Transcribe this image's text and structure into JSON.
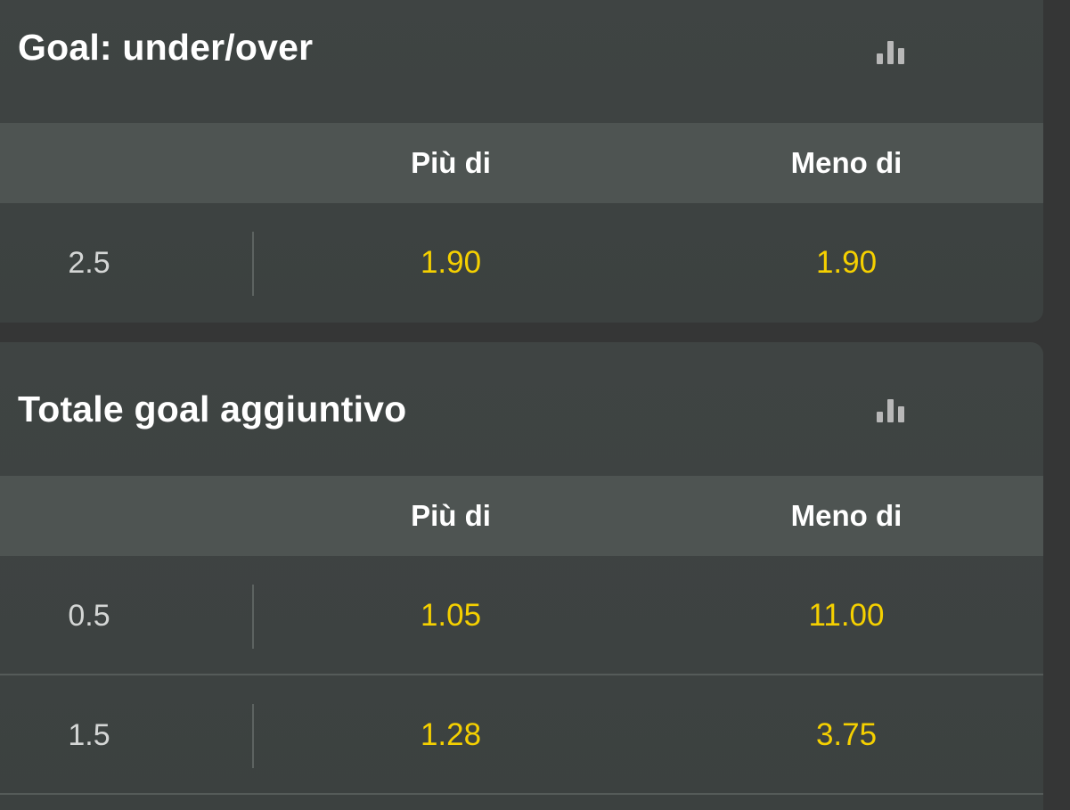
{
  "markets": [
    {
      "title": "Goal: under/over",
      "stats_icon": "bar-chart-icon",
      "columns": {
        "over": "Più di",
        "under": "Meno di"
      },
      "rows": [
        {
          "line": "2.5",
          "over": "1.90",
          "under": "1.90"
        }
      ]
    },
    {
      "title": "Totale goal aggiuntivo",
      "stats_icon": "bar-chart-icon",
      "columns": {
        "over": "Più di",
        "under": "Meno di"
      },
      "rows": [
        {
          "line": "0.5",
          "over": "1.05",
          "under": "11.00"
        },
        {
          "line": "1.5",
          "over": "1.28",
          "under": "3.75"
        }
      ]
    }
  ],
  "colors": {
    "odds": "#f5d000",
    "card_bg": "#3f4443",
    "column_header_bg": "#4e5452",
    "page_bg": "#353636"
  }
}
